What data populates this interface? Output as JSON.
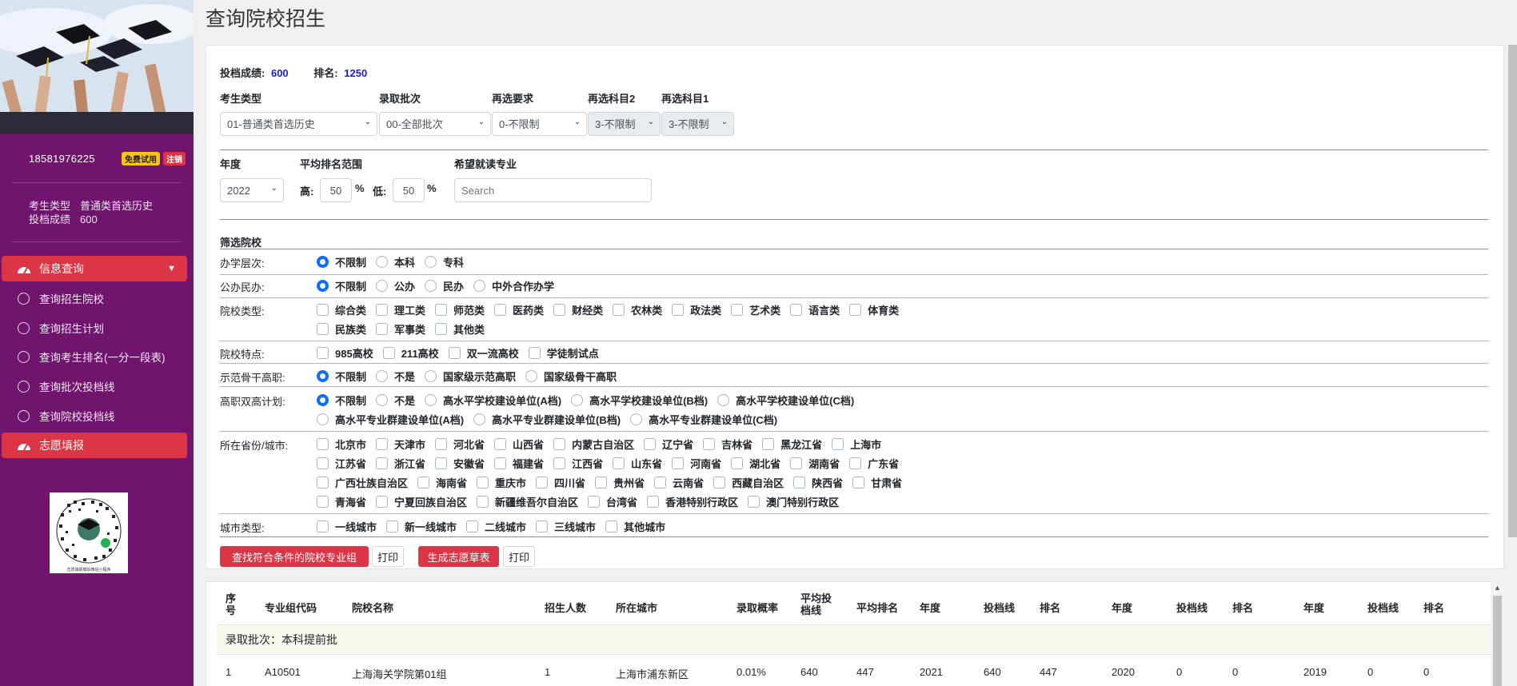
{
  "sidebar": {
    "phone": "18581976225",
    "badge_trial": "免费试用",
    "badge_logout": "注销",
    "candidate_type_label": "考生类型",
    "candidate_type_value": "普通类首选历史",
    "score_label": "投档成绩",
    "score_value": "600",
    "nav_info": "信息查询",
    "nav_items": [
      {
        "label": "查询招生院校"
      },
      {
        "label": "查询招生计划"
      },
      {
        "label": "查询考生排名(一分一段表)"
      },
      {
        "label": "查询批次投档线"
      },
      {
        "label": "查询院校投档线"
      }
    ],
    "nav_volunteer": "志愿填报",
    "qr_caption": "志愿填报模拟微信小程序"
  },
  "page": {
    "title": "查询院校招生"
  },
  "summary": {
    "score_label": "投档成绩:",
    "score_value": "600",
    "rank_label": "排名:",
    "rank_value": "1250"
  },
  "filters": {
    "candidate_type_label": "考生类型",
    "candidate_type_value": "01-普通类首选历史",
    "batch_label": "录取批次",
    "batch_value": "00-全部批次",
    "reselect_req_label": "再选要求",
    "reselect_req_value": "0-不限制",
    "subject2_label": "再选科目2",
    "subject2_value": "3-不限制",
    "subject1_label": "再选科目1",
    "subject1_value": "3-不限制",
    "year_label": "年度",
    "year_value": "2022",
    "rank_range_label": "平均排名范围",
    "high_label": "高:",
    "high_value": "50",
    "low_label": "低:",
    "low_value": "50",
    "percent": "%",
    "major_label": "希望就读专业",
    "major_placeholder": "Search",
    "screen_title": "筛选院校",
    "level_label": "办学层次:",
    "level_opts": [
      "不限制",
      "本科",
      "专科"
    ],
    "ownership_label": "公办民办:",
    "ownership_opts": [
      "不限制",
      "公办",
      "民办",
      "中外合作办学"
    ],
    "school_type_label": "院校类型:",
    "school_type_opts_row1": [
      "综合类",
      "理工类",
      "师范类",
      "医药类",
      "财经类",
      "农林类",
      "政法类",
      "艺术类",
      "语言类",
      "体育类"
    ],
    "school_type_opts_row2": [
      "民族类",
      "军事类",
      "其他类"
    ],
    "feature_label": "院校特点:",
    "feature_opts": [
      "985高校",
      "211高校",
      "双一流高校",
      "学徒制试点"
    ],
    "demo_label": "示范骨干高职:",
    "demo_opts": [
      "不限制",
      "不是",
      "国家级示范高职",
      "国家级骨干高职"
    ],
    "double_high_label": "高职双高计划:",
    "double_high_row1": [
      "不限制",
      "不是",
      "高水平学校建设单位(A档)",
      "高水平学校建设单位(B档)",
      "高水平学校建设单位(C档)"
    ],
    "double_high_row2": [
      "高水平专业群建设单位(A档)",
      "高水平专业群建设单位(B档)",
      "高水平专业群建设单位(C档)"
    ],
    "province_label": "所在省份/城市:",
    "province_row1": [
      "北京市",
      "天津市",
      "河北省",
      "山西省",
      "内蒙古自治区",
      "辽宁省",
      "吉林省",
      "黑龙江省",
      "上海市"
    ],
    "province_row2": [
      "江苏省",
      "浙江省",
      "安徽省",
      "福建省",
      "江西省",
      "山东省",
      "河南省",
      "湖北省",
      "湖南省",
      "广东省"
    ],
    "province_row3": [
      "广西壮族自治区",
      "海南省",
      "重庆市",
      "四川省",
      "贵州省",
      "云南省",
      "西藏自治区",
      "陕西省",
      "甘肃省"
    ],
    "province_row4": [
      "青海省",
      "宁夏回族自治区",
      "新疆维吾尔自治区",
      "台湾省",
      "香港特别行政区",
      "澳门特别行政区"
    ],
    "city_type_label": "城市类型:",
    "city_type_opts": [
      "一线城市",
      "新一线城市",
      "二线城市",
      "三线城市",
      "其他城市"
    ],
    "btn_search": "查找符合条件的院校专业组",
    "btn_print1": "打印",
    "btn_draft": "生成志愿草表",
    "btn_print2": "打印"
  },
  "table": {
    "headers": {
      "seq": "序号",
      "code": "专业组代码",
      "name": "院校名称",
      "enroll": "招生人数",
      "city": "所在城市",
      "prob": "录取概率",
      "avg_line": "平均投档线",
      "avg_rank": "平均排名",
      "year1": "年度",
      "line1": "投档线",
      "rank1": "排名",
      "year2": "年度",
      "line2": "投档线",
      "rank2": "排名",
      "year3": "年度",
      "line3": "投档线",
      "rank3": "排名"
    },
    "group_label": "录取批次：本科提前批",
    "row1": {
      "seq": "1",
      "code": "A10501",
      "name": "上海海关学院第01组",
      "enroll": "1",
      "city": "上海市浦东新区",
      "prob": "0.01%",
      "avg_line": "640",
      "avg_rank": "447",
      "year1": "2021",
      "line1": "640",
      "rank1": "447",
      "year2": "2020",
      "line2": "0",
      "rank2": "0",
      "year3": "2019",
      "line3": "0",
      "rank3": "0"
    }
  }
}
